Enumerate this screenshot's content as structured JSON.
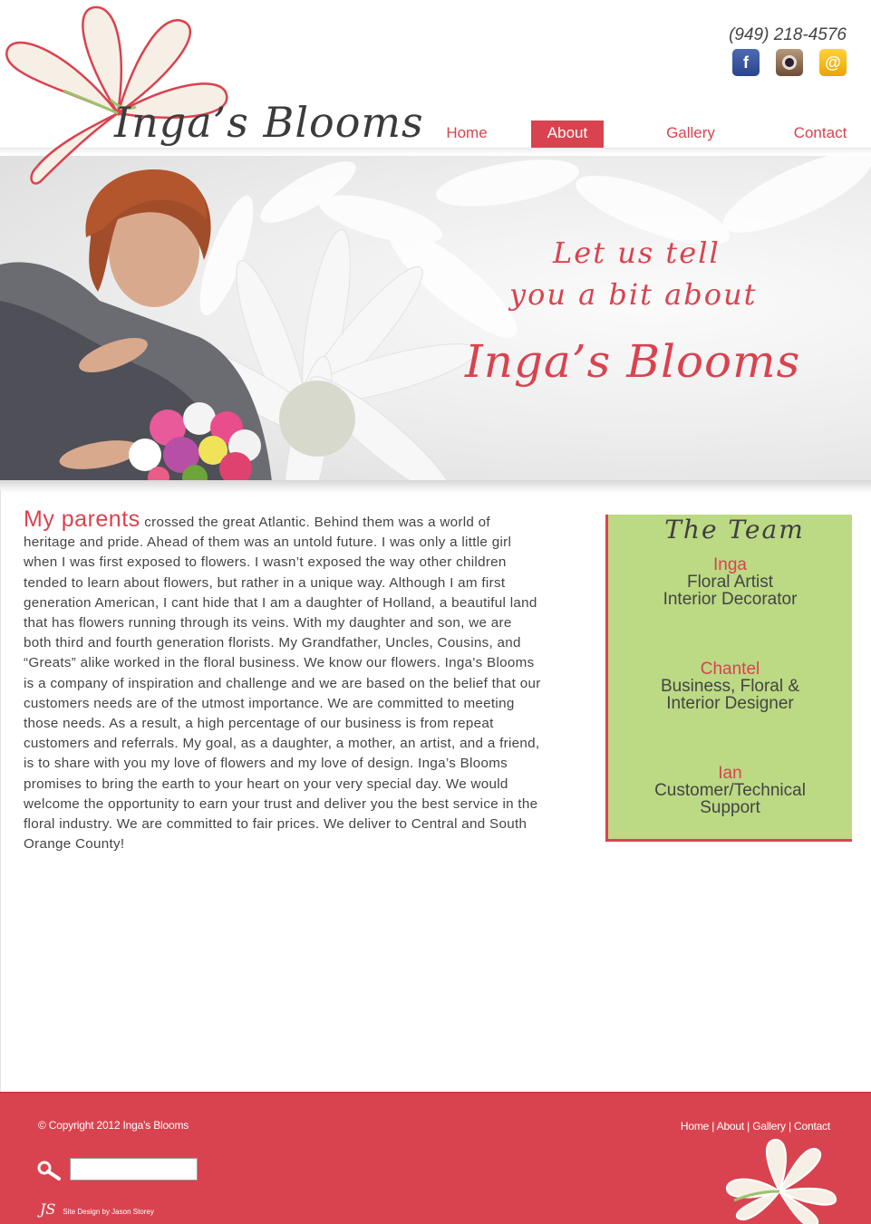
{
  "header": {
    "logo_text": "Inga’s Blooms",
    "phone": "(949) 218-4576",
    "social": [
      {
        "icon": "facebook-icon",
        "glyph": "f"
      },
      {
        "icon": "instagram-icon",
        "glyph": ""
      },
      {
        "icon": "email-icon",
        "glyph": "@"
      }
    ]
  },
  "nav": {
    "items": [
      "Home",
      "About",
      "Gallery",
      "Contact"
    ],
    "active": "About"
  },
  "hero": {
    "line1": "Let us tell",
    "line2": "you a bit about",
    "line3": "Inga’s Blooms"
  },
  "story": {
    "lead": "My parents",
    "body": " crossed the great Atlantic. Behind them was a world of heritage and pride. Ahead of them was an untold future. I was only a little girl when I was first exposed to flowers. I wasn’t exposed the way other children tended to learn about flowers, but rather in a unique way. Although I am first generation American, I cant hide that I am a daughter of Holland, a beautiful land that has flowers running through its veins. With my daughter and son, we are both third and fourth generation florists. My Grandfather, Uncles, Cousins, and “Greats” alike worked in the floral business. We know our flowers. Inga's Blooms is a company of inspiration and challenge and we are based on the belief that our customers needs are of the utmost importance. We are committed to meeting those needs. As a result, a high percentage of our business is from repeat customers and referrals. My goal, as a daughter, a mother, an artist, and a friend, is to share with you my love of flowers and my love of design. Inga’s Blooms promises to bring the earth to your heart on your very special day. We would welcome the opportunity to earn your trust and deliver you the best service in the floral industry. We are committed to fair prices. We deliver to Central and South Orange County!"
  },
  "team": {
    "title": "The Team",
    "members": [
      {
        "name": "Inga",
        "role1": "Floral Artist",
        "role2": "Interior Decorator"
      },
      {
        "name": "Chantel",
        "role1": "Business, Floral &",
        "role2": "Interior Designer"
      },
      {
        "name": "Ian",
        "role1": "Customer/Technical",
        "role2": "Support"
      }
    ]
  },
  "footer": {
    "copyright": "© Copyright 2012 Inga’s Blooms",
    "links": [
      "Home",
      "About",
      "Gallery",
      "Contact"
    ],
    "search_placeholder": "",
    "credit_mark": "JS",
    "credit": "Site Design by Jason Storey"
  },
  "colors": {
    "accent": "#d9434f",
    "team_bg": "#bcd984",
    "footer_bg": "#d9434f"
  }
}
